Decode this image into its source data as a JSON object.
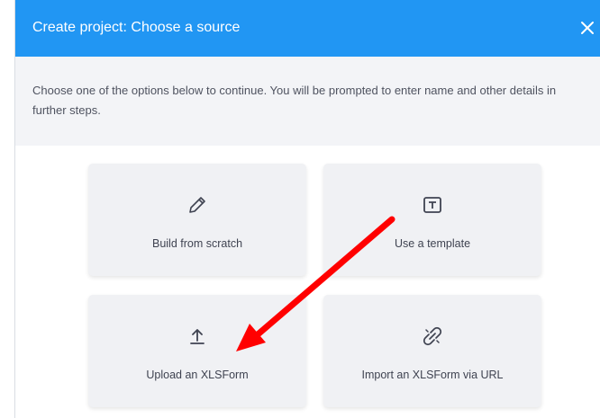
{
  "dialog": {
    "title": "Create project: Choose a source",
    "close_icon": "close-icon",
    "intro": "Choose one of the options below to continue. You will be prompted to enter name and other details in further steps."
  },
  "options": [
    {
      "label": "Build from scratch",
      "icon": "pencil-icon"
    },
    {
      "label": "Use a template",
      "icon": "template-icon"
    },
    {
      "label": "Upload an XLSForm",
      "icon": "upload-icon"
    },
    {
      "label": "Import an XLSForm via URL",
      "icon": "link-icon"
    }
  ],
  "annotation": {
    "type": "arrow",
    "color": "#ff0000",
    "points_to": "Upload an XLSForm"
  },
  "colors": {
    "header": "#2196f3",
    "intro_bg": "#f3f4f7",
    "card_bg": "#f0f1f4",
    "text": "#3f4351"
  }
}
